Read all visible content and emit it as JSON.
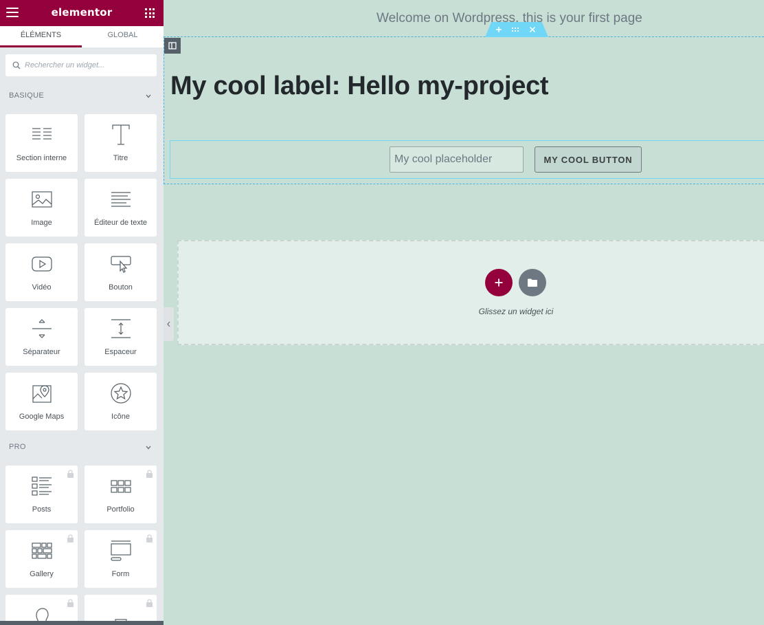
{
  "sidebar": {
    "brand": "elementor",
    "tabs": [
      {
        "label": "ÉLÉMENTS",
        "active": true
      },
      {
        "label": "GLOBAL",
        "active": false
      }
    ],
    "search": {
      "placeholder": "Rechercher un widget..."
    },
    "categories": [
      {
        "label": "BASIQUE",
        "widgets": [
          {
            "label": "Section interne",
            "icon": "columns-icon"
          },
          {
            "label": "Titre",
            "icon": "heading-icon"
          },
          {
            "label": "Image",
            "icon": "image-icon"
          },
          {
            "label": "Éditeur de texte",
            "icon": "text-editor-icon"
          },
          {
            "label": "Vidéo",
            "icon": "video-icon"
          },
          {
            "label": "Bouton",
            "icon": "button-icon"
          },
          {
            "label": "Séparateur",
            "icon": "divider-icon"
          },
          {
            "label": "Espaceur",
            "icon": "spacer-icon"
          },
          {
            "label": "Google Maps",
            "icon": "map-icon"
          },
          {
            "label": "Icône",
            "icon": "star-icon"
          }
        ]
      },
      {
        "label": "PRO",
        "widgets": [
          {
            "label": "Posts",
            "icon": "posts-icon",
            "locked": true
          },
          {
            "label": "Portfolio",
            "icon": "portfolio-icon",
            "locked": true
          },
          {
            "label": "Gallery",
            "icon": "gallery-icon",
            "locked": true
          },
          {
            "label": "Form",
            "icon": "form-icon",
            "locked": true
          },
          {
            "label": "",
            "icon": "author-icon",
            "locked": true
          },
          {
            "label": "",
            "icon": "slides-icon",
            "locked": true
          }
        ]
      }
    ]
  },
  "canvas": {
    "welcome": "Welcome on Wordpress, this is your first page",
    "heading": "My cool label: Hello my-project",
    "input_placeholder": "My cool placeholder",
    "button_label": "MY COOL BUTTON",
    "drop_text": "Glissez un widget ici"
  },
  "colors": {
    "brand": "#93003c",
    "canvas_bg": "#c8dfd6",
    "section_handle": "#71d7f7"
  }
}
